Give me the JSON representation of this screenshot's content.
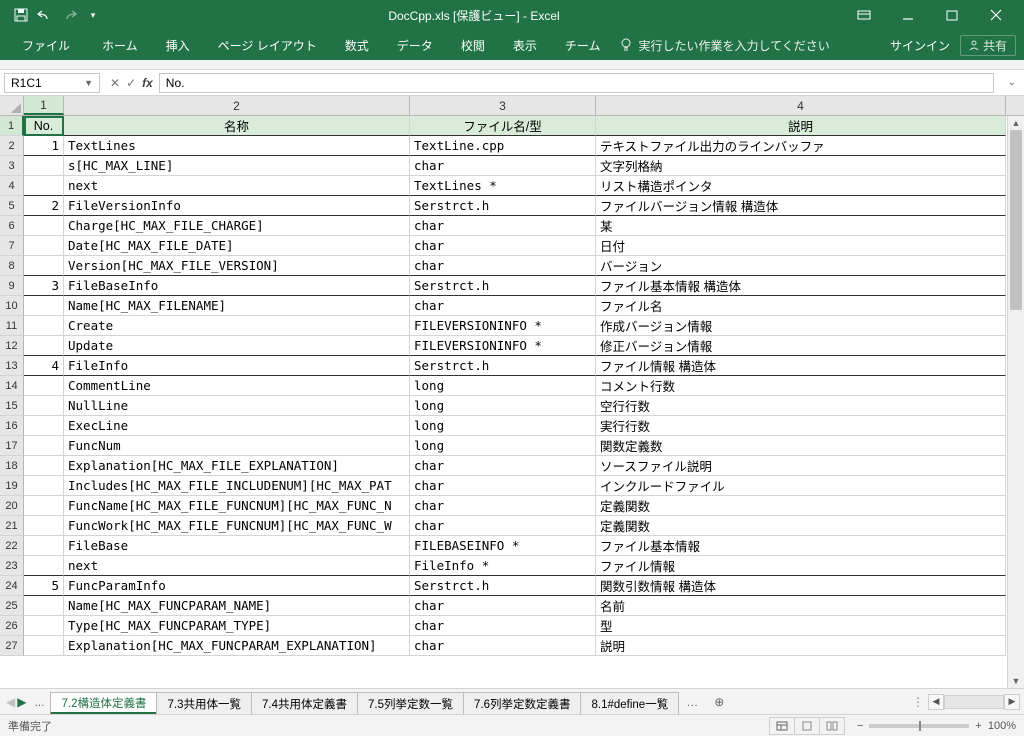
{
  "title": "DocCpp.xls [保護ビュー] - Excel",
  "qat": {
    "save": "save",
    "undo": "undo",
    "redo": "redo"
  },
  "window": {
    "signin": "サインイン",
    "share": "共有"
  },
  "ribbon": {
    "file": "ファイル",
    "tabs": [
      "ホーム",
      "挿入",
      "ページ レイアウト",
      "数式",
      "データ",
      "校閲",
      "表示",
      "チーム"
    ],
    "tellme": "実行したい作業を入力してください"
  },
  "formula": {
    "name_box": "R1C1",
    "value": "No."
  },
  "columns": [
    "1",
    "2",
    "3",
    "4"
  ],
  "header_row": [
    "No.",
    "名称",
    "ファイル名/型",
    "説明"
  ],
  "rows": [
    {
      "no": "1",
      "name": "TextLines",
      "type": "TextLine.cpp",
      "desc": "テキストファイル出力のラインバッファ",
      "striped": true
    },
    {
      "no": "",
      "name": "s[HC_MAX_LINE]",
      "type": "char",
      "desc": "文字列格納"
    },
    {
      "no": "",
      "name": "next",
      "type": "TextLines *",
      "desc": "リスト構造ポインタ",
      "striped": true
    },
    {
      "no": "2",
      "name": "FileVersionInfo",
      "type": "Serstrct.h",
      "desc": "ファイルバージョン情報 構造体",
      "striped": true
    },
    {
      "no": "",
      "name": "Charge[HC_MAX_FILE_CHARGE]",
      "type": "char",
      "desc": "某"
    },
    {
      "no": "",
      "name": "Date[HC_MAX_FILE_DATE]",
      "type": "char",
      "desc": "日付"
    },
    {
      "no": "",
      "name": "Version[HC_MAX_FILE_VERSION]",
      "type": "char",
      "desc": "バージョン",
      "striped": true
    },
    {
      "no": "3",
      "name": "FileBaseInfo",
      "type": "Serstrct.h",
      "desc": "ファイル基本情報 構造体",
      "striped": true
    },
    {
      "no": "",
      "name": "Name[HC_MAX_FILENAME]",
      "type": "char",
      "desc": "ファイル名"
    },
    {
      "no": "",
      "name": "Create",
      "type": "FILEVERSIONINFO *",
      "desc": "作成バージョン情報"
    },
    {
      "no": "",
      "name": "Update",
      "type": "FILEVERSIONINFO *",
      "desc": "修正バージョン情報",
      "striped": true
    },
    {
      "no": "4",
      "name": "FileInfo",
      "type": "Serstrct.h",
      "desc": "ファイル情報 構造体",
      "striped": true
    },
    {
      "no": "",
      "name": "CommentLine",
      "type": "long",
      "desc": "コメント行数"
    },
    {
      "no": "",
      "name": "NullLine",
      "type": "long",
      "desc": "空行行数"
    },
    {
      "no": "",
      "name": "ExecLine",
      "type": "long",
      "desc": "実行行数"
    },
    {
      "no": "",
      "name": "FuncNum",
      "type": "long",
      "desc": "関数定義数"
    },
    {
      "no": "",
      "name": "Explanation[HC_MAX_FILE_EXPLANATION]",
      "type": "char",
      "desc": "ソースファイル説明"
    },
    {
      "no": "",
      "name": "Includes[HC_MAX_FILE_INCLUDENUM][HC_MAX_PAT",
      "type": "char",
      "desc": "インクルードファイル"
    },
    {
      "no": "",
      "name": "FuncName[HC_MAX_FILE_FUNCNUM][HC_MAX_FUNC_N",
      "type": "char",
      "desc": "定義関数"
    },
    {
      "no": "",
      "name": "FuncWork[HC_MAX_FILE_FUNCNUM][HC_MAX_FUNC_W",
      "type": "char",
      "desc": "定義関数"
    },
    {
      "no": "",
      "name": "FileBase",
      "type": "FILEBASEINFO *",
      "desc": "ファイル基本情報"
    },
    {
      "no": "",
      "name": "next",
      "type": "FileInfo *",
      "desc": "ファイル情報",
      "striped": true
    },
    {
      "no": "5",
      "name": "FuncParamInfo",
      "type": "Serstrct.h",
      "desc": "関数引数情報 構造体",
      "striped": true
    },
    {
      "no": "",
      "name": "Name[HC_MAX_FUNCPARAM_NAME]",
      "type": "char",
      "desc": "名前"
    },
    {
      "no": "",
      "name": "Type[HC_MAX_FUNCPARAM_TYPE]",
      "type": "char",
      "desc": "型"
    },
    {
      "no": "",
      "name": "Explanation[HC_MAX_FUNCPARAM_EXPLANATION]",
      "type": "char",
      "desc": "説明"
    }
  ],
  "sheets": {
    "ellipsis": "...",
    "tabs": [
      "7.2構造体定義書",
      "7.3共用体一覧",
      "7.4共用体定義書",
      "7.5列挙定数一覧",
      "7.6列挙定数定義書",
      "8.1#define一覧"
    ],
    "active": 0
  },
  "status": {
    "ready": "準備完了",
    "zoom": "100%"
  }
}
